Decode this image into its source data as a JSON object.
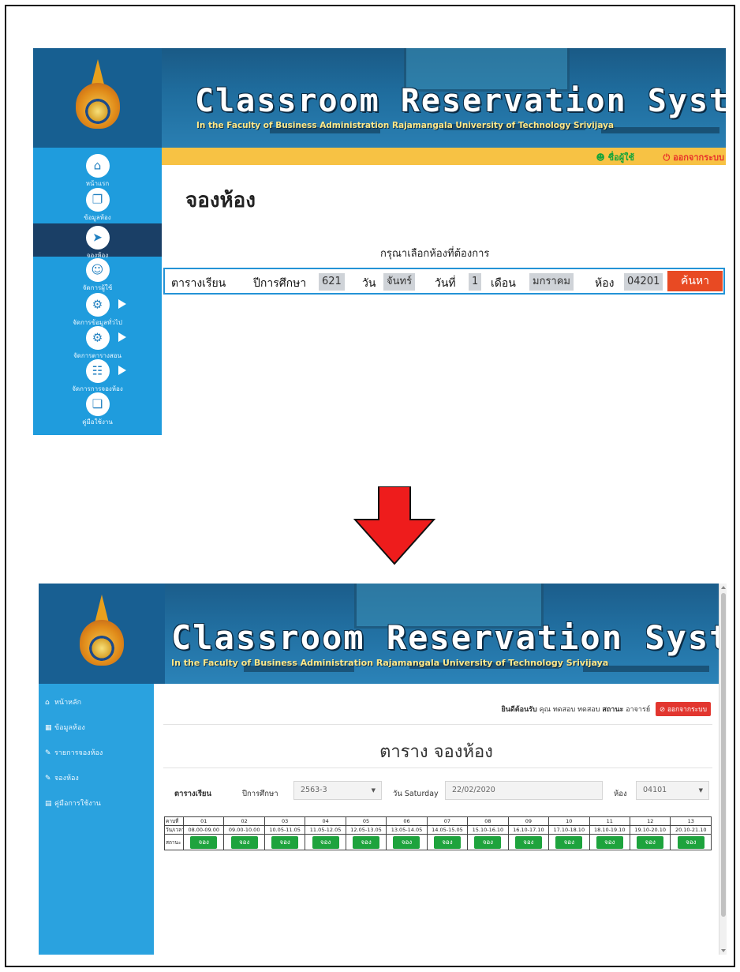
{
  "screen1": {
    "title": "Classroom Reservation System",
    "subtitle": "In the Faculty of Business Administration Rajamangala University of Technology Srivijaya",
    "sidebar": [
      {
        "label": "หน้าแรก",
        "icon": "home-icon",
        "glyph": "⌂"
      },
      {
        "label": "ข้อมูลห้อง",
        "icon": "documents-icon",
        "glyph": "❐"
      },
      {
        "label": "จองห้อง",
        "icon": "cursor-icon",
        "glyph": "➤"
      },
      {
        "label": "จัดการผู้ใช้",
        "icon": "user-gear-icon",
        "glyph": "☺"
      },
      {
        "label": "จัดการข้อมูลทั่วไป",
        "icon": "chart-gear-icon",
        "glyph": "⚙"
      },
      {
        "label": "จัดการตารางสอน",
        "icon": "schedule-gear-icon",
        "glyph": "⚙"
      },
      {
        "label": "จัดการการจองห้อง",
        "icon": "sitemap-icon",
        "glyph": "☷"
      },
      {
        "label": "คู่มือใช้งาน",
        "icon": "book-icon",
        "glyph": "❏"
      }
    ],
    "topbar": {
      "user": "ชื่อผู้ใช้",
      "logout": "ออกจากระบบ"
    },
    "heading": "จองห้อง",
    "prompt": "กรุณาเลือกห้องที่ต้องการ",
    "form": {
      "schedule_label": "ตารางเรียน",
      "year_label": "ปีการศึกษา",
      "year_value": "621",
      "day_label": "วัน",
      "day_value": "จันทร์",
      "date_label": "วันที่",
      "date_value": "1",
      "month_label": "เดือน",
      "month_value": "มกราคม",
      "room_label": "ห้อง",
      "room_value": "04201",
      "search_button": "ค้นหา"
    }
  },
  "screen2": {
    "title": "Classroom Reservation System",
    "subtitle": "In the Faculty of Business Administration Rajamangala University of Technology Srivijaya",
    "sidebar": [
      {
        "label": "หน้าหลัก",
        "icon": "home-icon",
        "glyph": "⌂"
      },
      {
        "label": "ข้อมูลห้อง",
        "icon": "table-icon",
        "glyph": "▦"
      },
      {
        "label": "รายการจองห้อง",
        "icon": "pencil-icon",
        "glyph": "✎"
      },
      {
        "label": "จองห้อง",
        "icon": "pencil-icon",
        "glyph": "✎"
      },
      {
        "label": "คู่มือการใช้งาน",
        "icon": "file-icon",
        "glyph": "▤"
      }
    ],
    "welcome": {
      "greeting": "ยินดีต้อนรับ",
      "user": "คุณ ทดสอบ ทดสอบ",
      "status_label": "สถานะ",
      "status_value": "อาจารย์",
      "logout": "ออกจากระบบ"
    },
    "heading": "ตาราง จองห้อง",
    "form": {
      "schedule_label": "ตารางเรียน",
      "year_label": "ปีการศึกษา",
      "year_value": "2563-3",
      "day_label": "วัน Saturday",
      "date_value": "22/02/2020",
      "room_label": "ห้อง",
      "room_value": "04101"
    },
    "table": {
      "row_labels": [
        "คาบที่",
        "วัน/เวลา",
        "สถานะ"
      ],
      "periods": [
        "01",
        "02",
        "03",
        "04",
        "05",
        "06",
        "07",
        "08",
        "09",
        "10",
        "11",
        "12",
        "13"
      ],
      "times": [
        "08.00-09.00",
        "09.00-10.00",
        "10.05-11.05",
        "11.05-12.05",
        "12.05-13.05",
        "13.05-14.05",
        "14.05-15.05",
        "15.10-16.10",
        "16.10-17.10",
        "17.10-18.10",
        "18.10-19.10",
        "19.10-20.10",
        "20.10-21.10"
      ],
      "book_label": "จอง"
    }
  },
  "colors": {
    "banner": "#1f6d9e",
    "sidebar1": "#1f9cdd",
    "topbar1": "#f7c244",
    "search_button": "#e84a23",
    "sidebar2": "#2aa2df",
    "book_button": "#1ea33d",
    "logout_button": "#e2362f",
    "arrow": "#ee1c1c"
  }
}
